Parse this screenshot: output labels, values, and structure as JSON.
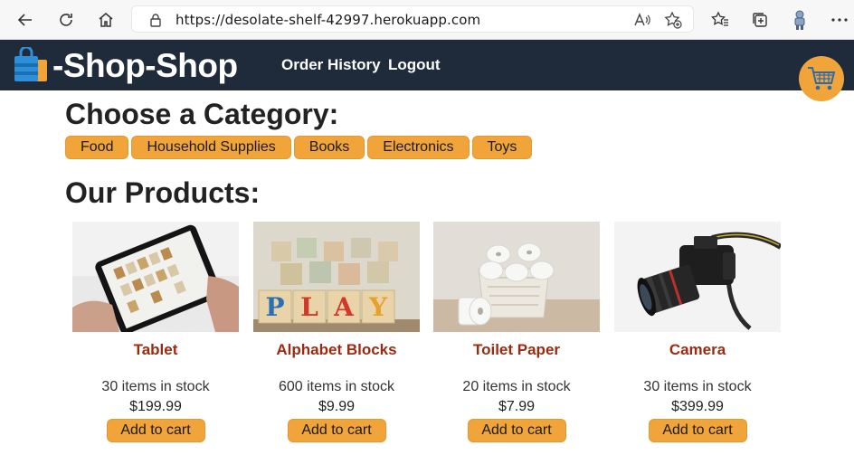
{
  "browser": {
    "url": "https://desolate-shelf-42997.herokuapp.com"
  },
  "header": {
    "title": "-Shop-Shop",
    "nav": [
      "Order History",
      "Logout"
    ]
  },
  "categories": {
    "heading": "Choose a Category:",
    "items": [
      "Food",
      "Household Supplies",
      "Books",
      "Electronics",
      "Toys"
    ]
  },
  "products": {
    "heading": "Our Products:",
    "add_label": "Add to cart",
    "items": [
      {
        "name": "Tablet",
        "stock": "30 items in stock",
        "price": "$199.99"
      },
      {
        "name": "Alphabet Blocks",
        "stock": "600 items in stock",
        "price": "$9.99"
      },
      {
        "name": "Toilet Paper",
        "stock": "20 items in stock",
        "price": "$7.99"
      },
      {
        "name": "Camera",
        "stock": "30 items in stock",
        "price": "$399.99"
      }
    ]
  },
  "block_letters": [
    "P",
    "L",
    "A",
    "Y"
  ],
  "colors": {
    "header_bg": "#1f2a3a",
    "accent": "#f0a43a",
    "product_name": "#9b2a10"
  }
}
